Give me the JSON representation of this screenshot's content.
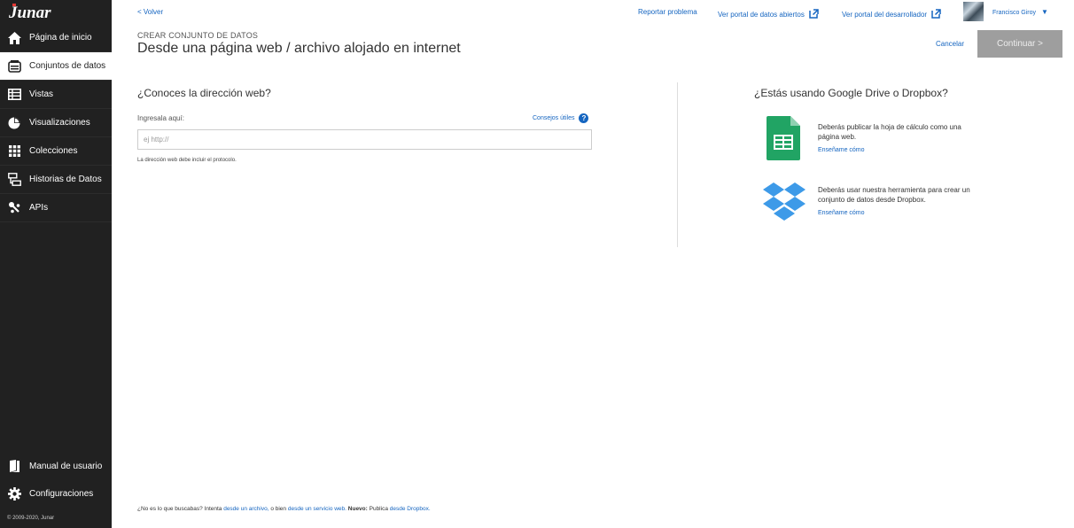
{
  "brand": {
    "logo_text": "Junar"
  },
  "sidebar": {
    "items": [
      {
        "label": "Página de inicio",
        "icon": "home-icon"
      },
      {
        "label": "Conjuntos de datos",
        "icon": "datasets-icon"
      },
      {
        "label": "Vistas",
        "icon": "table-icon"
      },
      {
        "label": "Visualizaciones",
        "icon": "pie-chart-icon"
      },
      {
        "label": "Colecciones",
        "icon": "grid-icon"
      },
      {
        "label": "Historias de Datos",
        "icon": "stories-icon"
      },
      {
        "label": "APIs",
        "icon": "api-icon"
      }
    ],
    "bottom_items": [
      {
        "label": "Manual de usuario",
        "icon": "book-icon"
      },
      {
        "label": "Configuraciones",
        "icon": "gear-icon"
      }
    ],
    "copyright": "© 2009-2020, Junar"
  },
  "header": {
    "back": "< Volver",
    "report": "Reportar problema",
    "open_portal": "Ver portal de datos abiertos",
    "dev_portal": "Ver portal del desarrollador",
    "user": "Francisco Giroy",
    "kicker": "CREAR CONJUNTO DE DATOS",
    "title": "Desde una página web / archivo alojado en internet",
    "cancel": "Cancelar",
    "continue": "Continuar >"
  },
  "form": {
    "question": "¿Conoces la dirección web?",
    "label": "Ingresala aquí:",
    "tips": "Consejos útiles",
    "placeholder": "ej http://",
    "hint": "La dirección web debe incluir el protocolo."
  },
  "alternatives": {
    "title": "¿Estás usando Google Drive o Dropbox?",
    "drive_text": "Deberás publicar la hoja de cálculo como una página web.",
    "drive_link": "Enseñame cómo",
    "dropbox_text": "Deberás usar nuestra herramienta para crear un conjunto de datos desde Dropbox.",
    "dropbox_link": "Enseñame cómo"
  },
  "footer": {
    "t1": "¿No es lo que buscabas? Intenta ",
    "l1": "desde un archivo,",
    "t2": " o bien ",
    "l2": "desde un servicio web.",
    "t3": " ",
    "bold": "Nuevo:",
    "t4": " Publica ",
    "l3": "desde Dropbox."
  },
  "colors": {
    "sidebar": "#212121",
    "link": "#1565c0",
    "continue_bg": "#9e9e9e",
    "sheets_green": "#21a464",
    "dropbox_blue": "#3d9ae8"
  }
}
